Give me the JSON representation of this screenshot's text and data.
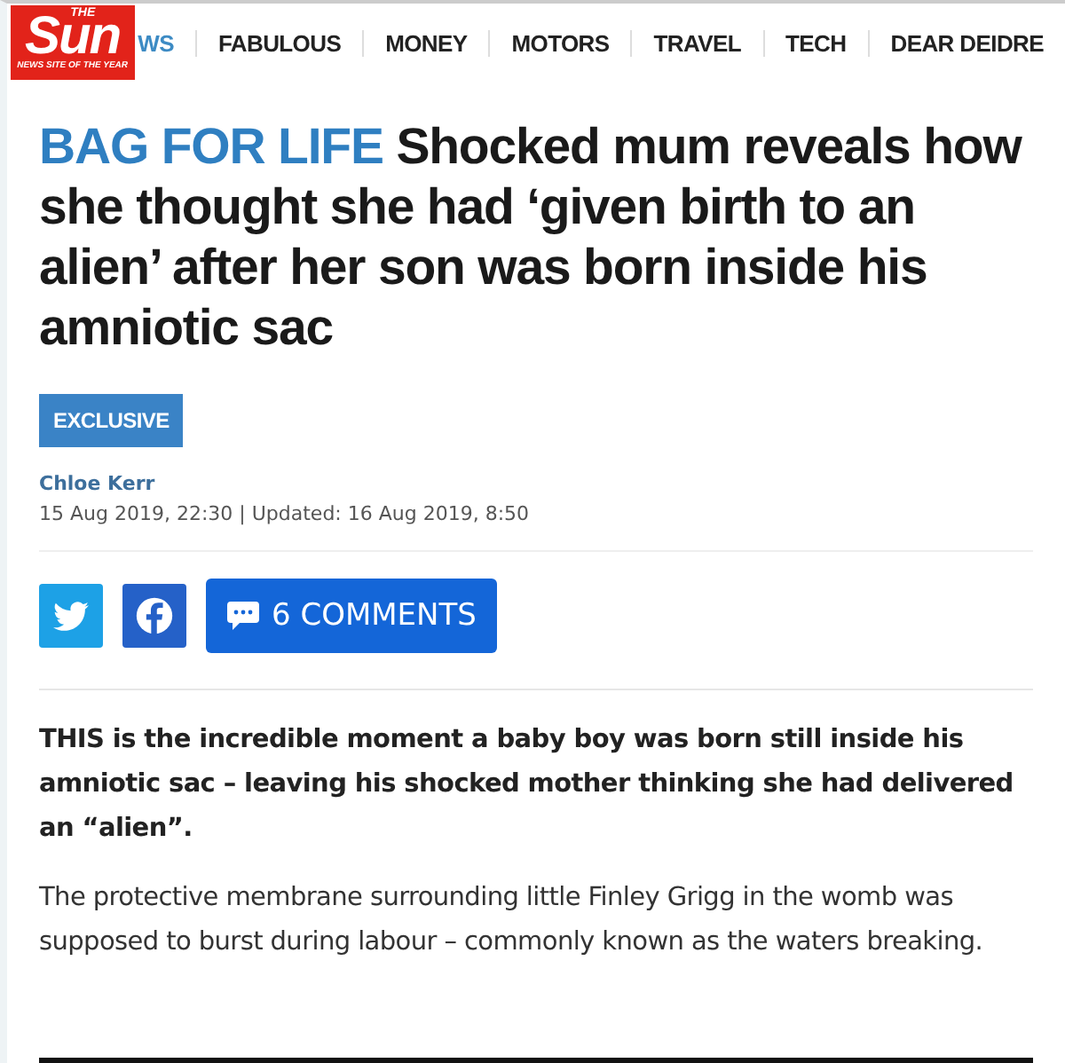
{
  "logo": {
    "title": "Sun",
    "kicker": "THE",
    "tagline": "NEWS SITE OF THE YEAR"
  },
  "nav": [
    {
      "label": "WS",
      "selected": true
    },
    {
      "label": "FABULOUS",
      "selected": false
    },
    {
      "label": "MONEY",
      "selected": false
    },
    {
      "label": "MOTORS",
      "selected": false
    },
    {
      "label": "TRAVEL",
      "selected": false
    },
    {
      "label": "TECH",
      "selected": false
    },
    {
      "label": "DEAR DEIDRE",
      "selected": false
    }
  ],
  "headline": {
    "kicker": "BAG FOR LIFE",
    "title": "Shocked mum reveals how she thought she had ‘given birth to an alien’ after her son was born inside his amniotic sac"
  },
  "tag": "EXCLUSIVE",
  "author": "Chloe Kerr",
  "dateline": "15 Aug 2019, 22:30 | Updated: 16 Aug 2019, 8:50",
  "share": [
    {
      "kind": "twitter"
    },
    {
      "kind": "facebook"
    }
  ],
  "comments": "6 COMMENTS",
  "paragraphs": [
    {
      "kind": "lead",
      "text": "THIS is the incredible moment a baby boy was born still inside his amniotic sac – leaving his shocked mother thinking she had delivered an “alien”."
    },
    {
      "kind": "body",
      "text": "The protective membrane surrounding little Finley Grigg in the womb was supposed to burst during labour – commonly known as the waters breaking."
    }
  ]
}
